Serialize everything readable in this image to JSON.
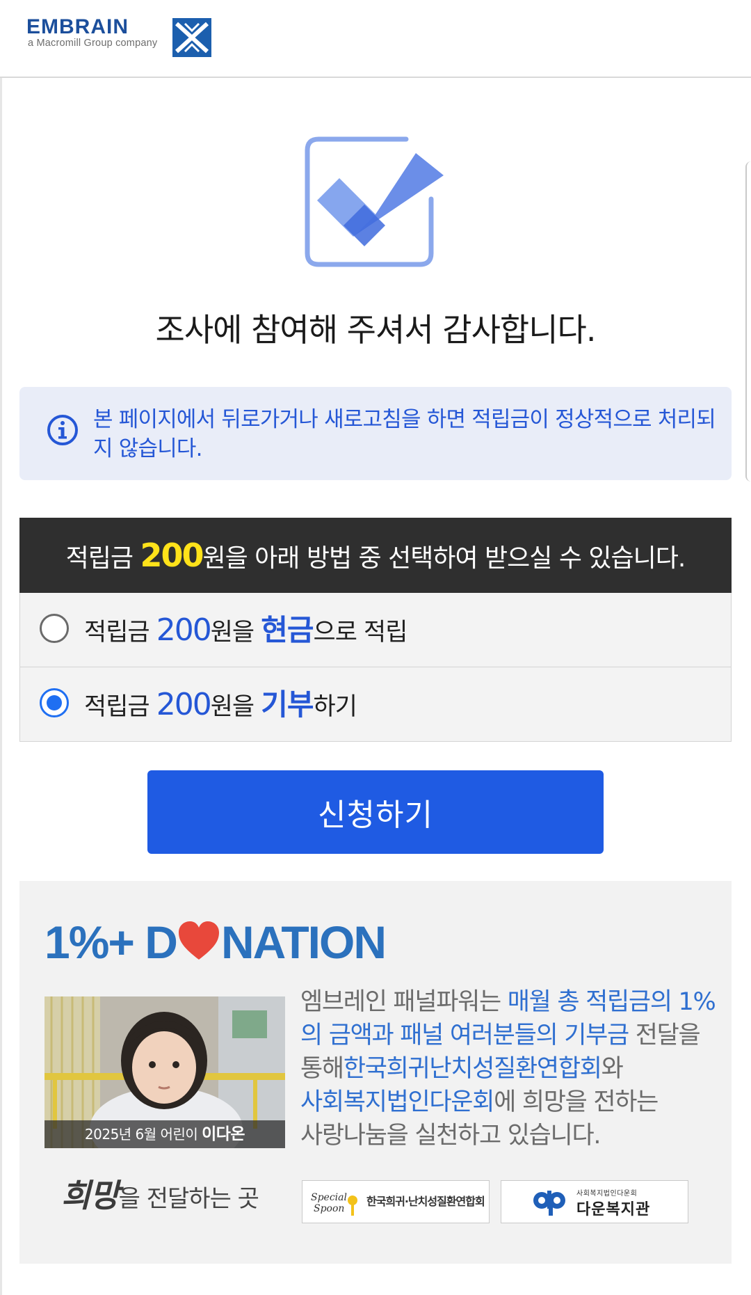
{
  "header": {
    "brand": "EMBRAIN",
    "brand_sub": "a Macromill Group company"
  },
  "completion": {
    "title": "조사에 참여해 주셔서 감사합니다."
  },
  "notice": {
    "text": "본 페이지에서 뒤로가거나 새로고침을 하면 적립금이 정상적으로 처리되지 않습니다."
  },
  "reward": {
    "header_prefix": "적립금 ",
    "amount": "200",
    "header_suffix": "원을 아래 방법 중 선택하여 받으실 수 있습니다.",
    "options": [
      {
        "prefix": "적립금 ",
        "amount": "200",
        "middle": "원을 ",
        "keyword": "현금",
        "suffix": "으로 적립",
        "selected": false
      },
      {
        "prefix": "적립금 ",
        "amount": "200",
        "middle": "원을 ",
        "keyword": "기부",
        "suffix": "하기",
        "selected": true
      }
    ],
    "submit_label": "신청하기"
  },
  "donation": {
    "logo_left": "1%+ D",
    "logo_right": "NATION",
    "photo_caption_prefix": "2025년 6월 어린이 ",
    "photo_caption_name": "이다온",
    "story": {
      "t1": "엠브레인 패널파워는 ",
      "h1": "매월 총 적립금의 1%의 금액과 패널 여러분들의 기부금",
      "t2": " 전달을 통해",
      "h2": "한국희귀난치성질환연합회",
      "t3": "와 ",
      "h3": "사회복지법인다운회",
      "t4": "에 희망을 전하는 사랑나눔을 실천하고 있습니다."
    },
    "partners_label_script": "희망",
    "partners_label": "을 전달하는 곳",
    "partner1_name": "한국희귀·난치성질환연합회",
    "partner2_small": "사회복지법인다운회",
    "partner2_name": "다운복지관"
  },
  "colors": {
    "accent_blue": "#1f5be3",
    "notice_bg": "#e9edf8",
    "amount_yellow": "#ffe21a",
    "donation_blue": "#2b71bd",
    "heart_red": "#e8483b"
  }
}
